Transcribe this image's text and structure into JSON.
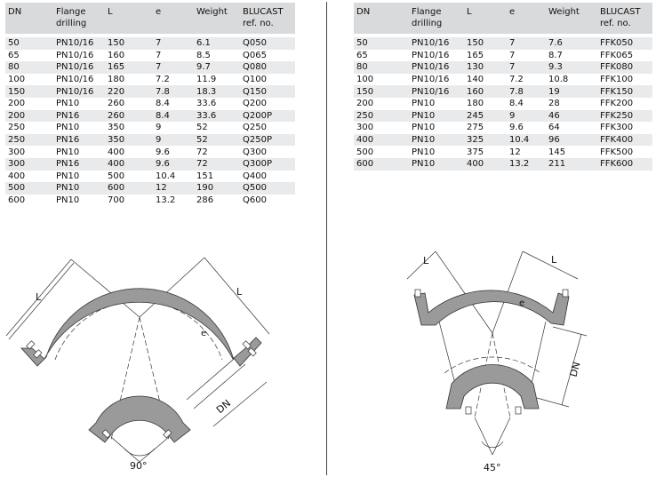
{
  "headers": {
    "dn": "DN",
    "flange_line1": "Flange",
    "flange_line2": "drilling",
    "l": "L",
    "e": "e",
    "weight": "Weight",
    "ref_line1": "BLUCAST",
    "ref_line2": "ref. no."
  },
  "table_90": [
    {
      "dn": "50",
      "flange": "PN10/16",
      "l": "150",
      "e": "7",
      "weight": "6.1",
      "ref": "Q050"
    },
    {
      "dn": "65",
      "flange": "PN10/16",
      "l": "160",
      "e": "7",
      "weight": "8.5",
      "ref": "Q065"
    },
    {
      "dn": "80",
      "flange": "PN10/16",
      "l": "165",
      "e": "7",
      "weight": "9.7",
      "ref": "Q080"
    },
    {
      "dn": "100",
      "flange": "PN10/16",
      "l": "180",
      "e": "7.2",
      "weight": "11.9",
      "ref": "Q100"
    },
    {
      "dn": "150",
      "flange": "PN10/16",
      "l": "220",
      "e": "7.8",
      "weight": "18.3",
      "ref": "Q150"
    },
    {
      "dn": "200",
      "flange": "PN10",
      "l": "260",
      "e": "8.4",
      "weight": "33.6",
      "ref": "Q200"
    },
    {
      "dn": "200",
      "flange": "PN16",
      "l": "260",
      "e": "8.4",
      "weight": "33.6",
      "ref": "Q200P"
    },
    {
      "dn": "250",
      "flange": "PN10",
      "l": "350",
      "e": "9",
      "weight": "52",
      "ref": "Q250"
    },
    {
      "dn": "250",
      "flange": "PN16",
      "l": "350",
      "e": "9",
      "weight": "52",
      "ref": "Q250P"
    },
    {
      "dn": "300",
      "flange": "PN10",
      "l": "400",
      "e": "9.6",
      "weight": "72",
      "ref": "Q300"
    },
    {
      "dn": "300",
      "flange": "PN16",
      "l": "400",
      "e": "9.6",
      "weight": "72",
      "ref": "Q300P"
    },
    {
      "dn": "400",
      "flange": "PN10",
      "l": "500",
      "e": "10.4",
      "weight": "151",
      "ref": "Q400"
    },
    {
      "dn": "500",
      "flange": "PN10",
      "l": "600",
      "e": "12",
      "weight": "190",
      "ref": "Q500"
    },
    {
      "dn": "600",
      "flange": "PN10",
      "l": "700",
      "e": "13.2",
      "weight": "286",
      "ref": "Q600"
    }
  ],
  "table_45": [
    {
      "dn": "50",
      "flange": "PN10/16",
      "l": "150",
      "e": "7",
      "weight": "7.6",
      "ref": "FFK050"
    },
    {
      "dn": "65",
      "flange": "PN10/16",
      "l": "165",
      "e": "7",
      "weight": "8.7",
      "ref": "FFK065"
    },
    {
      "dn": "80",
      "flange": "PN10/16",
      "l": "130",
      "e": "7",
      "weight": "9.3",
      "ref": "FFK080"
    },
    {
      "dn": "100",
      "flange": "PN10/16",
      "l": "140",
      "e": "7.2",
      "weight": "10.8",
      "ref": "FFK100"
    },
    {
      "dn": "150",
      "flange": "PN10/16",
      "l": "160",
      "e": "7.8",
      "weight": "19",
      "ref": "FFK150"
    },
    {
      "dn": "200",
      "flange": "PN10",
      "l": "180",
      "e": "8.4",
      "weight": "28",
      "ref": "FFK200"
    },
    {
      "dn": "250",
      "flange": "PN10",
      "l": "245",
      "e": "9",
      "weight": "46",
      "ref": "FFK250"
    },
    {
      "dn": "300",
      "flange": "PN10",
      "l": "275",
      "e": "9.6",
      "weight": "64",
      "ref": "FFK300"
    },
    {
      "dn": "400",
      "flange": "PN10",
      "l": "325",
      "e": "10.4",
      "weight": "96",
      "ref": "FFK400"
    },
    {
      "dn": "500",
      "flange": "PN10",
      "l": "375",
      "e": "12",
      "weight": "145",
      "ref": "FFK500"
    },
    {
      "dn": "600",
      "flange": "PN10",
      "l": "400",
      "e": "13.2",
      "weight": "211",
      "ref": "FFK600"
    }
  ],
  "drawing_90": {
    "l_label": "L",
    "e_label": "e",
    "dn_label": "DN",
    "angle_label": "90°"
  },
  "drawing_45": {
    "l_label": "L",
    "e_label": "e",
    "dn_label": "DN",
    "angle_label": "45°"
  },
  "colors": {
    "header_bg": "#d9dadc",
    "stripe_bg": "#e9eaec",
    "casting_fill": "#9a9a9a"
  }
}
